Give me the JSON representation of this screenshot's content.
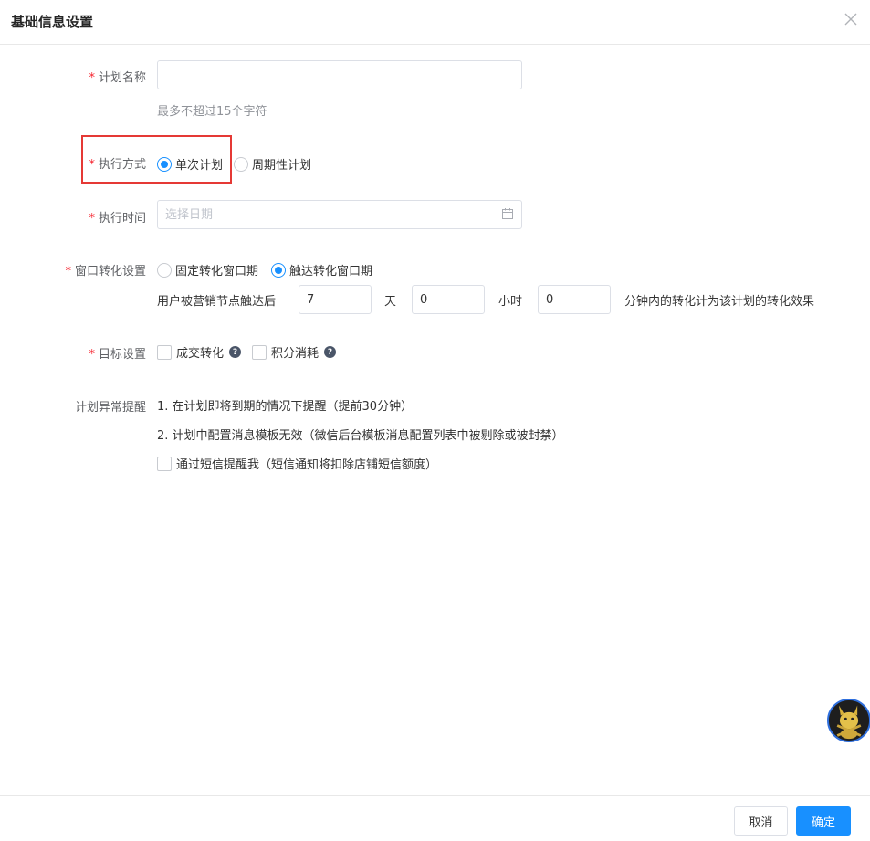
{
  "dialog": {
    "title": "基础信息设置"
  },
  "form": {
    "plan_name": {
      "label": "计划名称",
      "value": "",
      "placeholder": "",
      "hint": "最多不超过15个字符"
    },
    "exec_mode": {
      "label": "执行方式",
      "options": [
        {
          "label": "单次计划",
          "checked": true
        },
        {
          "label": "周期性计划",
          "checked": false
        }
      ]
    },
    "exec_time": {
      "label": "执行时间",
      "placeholder": "选择日期"
    },
    "window": {
      "label": "窗口转化设置",
      "options": [
        {
          "label": "固定转化窗口期",
          "checked": false
        },
        {
          "label": "触达转化窗口期",
          "checked": true
        }
      ],
      "prefix": "用户被营销节点触达后",
      "days_value": "7",
      "days_unit": "天",
      "hours_value": "0",
      "hours_unit": "小时",
      "minutes_value": "0",
      "suffix": "分钟内的转化计为该计划的转化效果"
    },
    "goal": {
      "label": "目标设置",
      "options": [
        {
          "label": "成交转化",
          "checked": false
        },
        {
          "label": "积分消耗",
          "checked": false
        }
      ],
      "help_glyph": "?"
    },
    "alert": {
      "label": "计划异常提醒",
      "line1": "1. 在计划即将到期的情况下提醒（提前30分钟）",
      "line2": "2. 计划中配置消息模板无效（微信后台模板消息配置列表中被剔除或被封禁）",
      "sms": {
        "label": "通过短信提醒我（短信通知将扣除店铺短信额度）",
        "checked": false
      }
    },
    "required_mark": "*"
  },
  "footer": {
    "cancel_label": "取消",
    "ok_label": "确定"
  },
  "colors": {
    "primary": "#1890ff",
    "required": "#f5222d",
    "highlight": "#e53935"
  }
}
